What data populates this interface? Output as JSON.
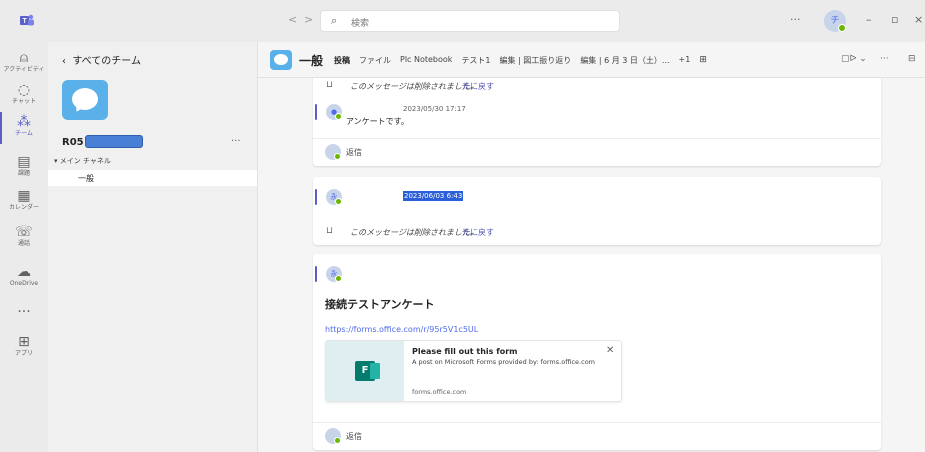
{
  "titlebar": {
    "search_placeholder": "検索",
    "back_glyph": "<",
    "forward_glyph": ">",
    "more_glyph": "···",
    "user_initial": "チ",
    "minimize_glyph": "–",
    "restore_glyph": "▫",
    "close_glyph": "×"
  },
  "rail": {
    "items": [
      {
        "label": "アクティビティ",
        "icon": "bell-icon",
        "glyph": "⍝"
      },
      {
        "label": "チャット",
        "icon": "chat-icon",
        "glyph": "◌"
      },
      {
        "label": "チーム",
        "icon": "teams-icon",
        "glyph": "⁂"
      },
      {
        "label": "課題",
        "icon": "assignments-icon",
        "glyph": "▤"
      },
      {
        "label": "カレンダー",
        "icon": "calendar-icon",
        "glyph": "▦"
      },
      {
        "label": "通話",
        "icon": "phone-icon",
        "glyph": "☏"
      },
      {
        "label": "OneDrive",
        "icon": "cloud-icon",
        "glyph": "☁"
      },
      {
        "label": "",
        "icon": "more-icon",
        "glyph": "···"
      },
      {
        "label": "アプリ",
        "icon": "apps-icon",
        "glyph": "⊞"
      }
    ]
  },
  "panel": {
    "back_label": "すべてのチーム",
    "team_name": "R05",
    "more_glyph": "···",
    "channel_header": "▾ メイン チャネル",
    "channel": "一般"
  },
  "header": {
    "title": "一般",
    "tabs": [
      "投稿",
      "ファイル",
      "Plc Notebook",
      "テスト1",
      "編集 | 図工振り返り",
      "編集 | 6 月 3 日（土）...",
      "+1"
    ],
    "add_glyph": "⊞",
    "video_glyph": "▢ᐅ ⌄",
    "more_glyph": "···",
    "panel_glyph": "⊟"
  },
  "messages": {
    "deleted_text": "このメッセージは削除されました。",
    "undo_label": "元に戻す",
    "reply_label": "返信",
    "msg1_timestamp": "2023/05/30 17:17",
    "msg1_text": "アンケートです。",
    "msg2_timestamp": "2023/06/03 6:43",
    "avatar_initial": "永",
    "post_title": "接続テストアンケート",
    "post_link": "https://forms.office.com/r/95r5V1c5UL",
    "preview_title": "Please fill out this form",
    "preview_desc": "A post on Microsoft Forms provided by: forms.office.com",
    "preview_domain": "forms.office.com",
    "forms_letter": "F"
  },
  "colors": {
    "accent": "#5b5fc7",
    "presence": "#6bb700",
    "link": "#4f6bed"
  }
}
